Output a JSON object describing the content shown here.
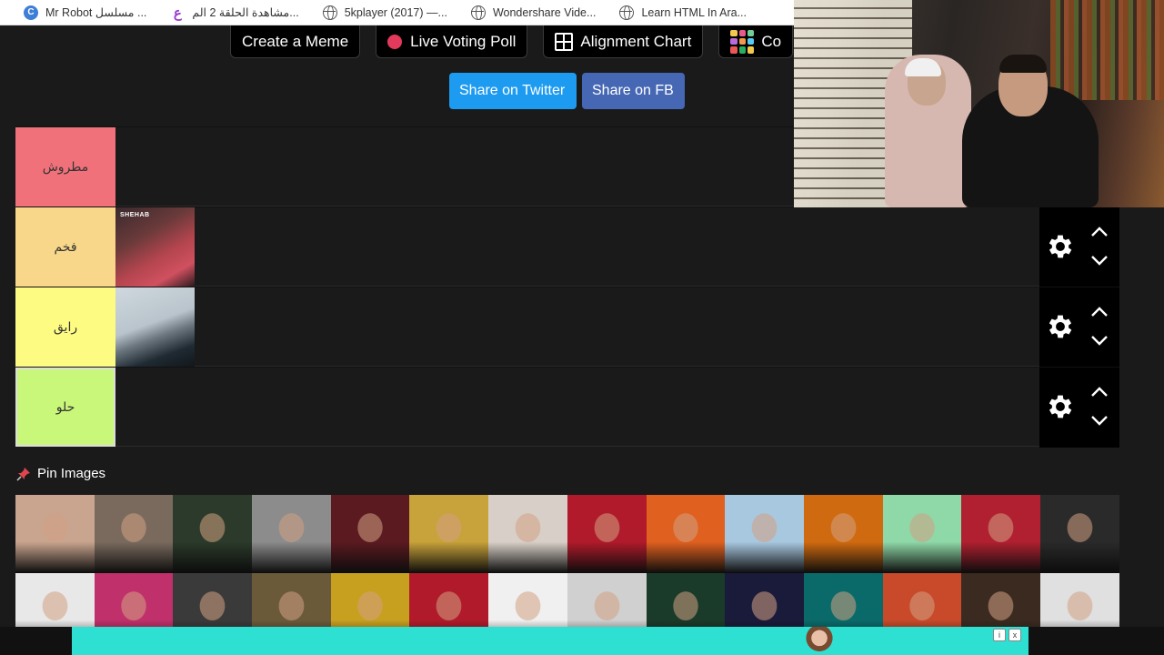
{
  "bookmarks": [
    {
      "label": "Mr Robot مسلسل ...",
      "icon": "c-icon"
    },
    {
      "label": "مشاهدة الحلقة 2 الم...",
      "icon": "arabic-site-icon"
    },
    {
      "label": "5kplayer (2017) —...",
      "icon": "globe-icon"
    },
    {
      "label": "Wondershare Vide...",
      "icon": "globe-icon"
    },
    {
      "label": "Learn HTML In Ara...",
      "icon": "globe-icon"
    }
  ],
  "top_buttons": {
    "create_meme": "Create a Meme",
    "live_voting": "Live Voting Poll",
    "alignment": "Alignment Chart",
    "colors": "Co"
  },
  "share": {
    "twitter": "Share on Twitter",
    "fb": "Share on FB"
  },
  "tiers": [
    {
      "label": "مطروش",
      "color": "#f0717a",
      "items": []
    },
    {
      "label": "فخم",
      "color": "#f8d68a",
      "items": [
        "SHEHAB"
      ]
    },
    {
      "label": "رايق",
      "color": "#fdfb82",
      "items": [
        ""
      ]
    },
    {
      "label": "حلو",
      "color": "#c9f77a",
      "items": []
    }
  ],
  "pin": {
    "title": "Pin Images"
  },
  "gallery_colors": [
    "#c9a58f",
    "#7a6a5e",
    "#2b3a2a",
    "#8c8c8c",
    "#5a1a20",
    "#c8a23a",
    "#d8d0c8",
    "#b01a2a",
    "#e06020",
    "#a8c8e0",
    "#d06a10",
    "#8fd8a8",
    "#b02030",
    "#2a2a2a",
    "#e8e8e8",
    "#c0306a",
    "#3a3a3a",
    "#6a5a3a",
    "#c8a020",
    "#b01a2a",
    "#f0f0f0",
    "#d0d0d0",
    "#1a3a2a",
    "#1a1a3a",
    "#0a6a6a",
    "#c84a2a",
    "#3a2a20",
    "#e0e0e0"
  ],
  "ad": {
    "info": "i",
    "close": "x"
  }
}
